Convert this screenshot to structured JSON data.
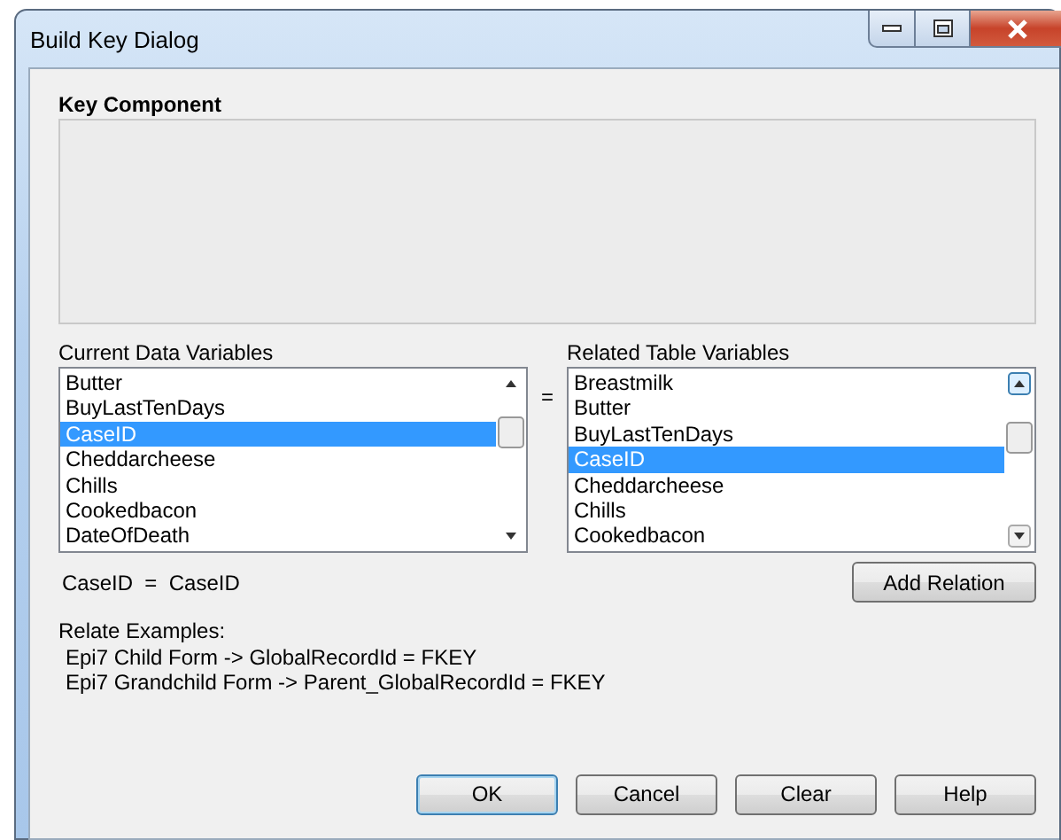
{
  "window": {
    "title": "Build Key Dialog"
  },
  "key_component": {
    "label": "Key Component"
  },
  "current_data_variables": {
    "label": "Current Data Variables",
    "items": [
      {
        "text": "Butter",
        "selected": false
      },
      {
        "text": "BuyLastTenDays",
        "selected": false
      },
      {
        "text": "CaseID",
        "selected": true
      },
      {
        "text": "Cheddarcheese",
        "selected": false
      },
      {
        "text": "Chills",
        "selected": false
      },
      {
        "text": "Cookedbacon",
        "selected": false
      },
      {
        "text": "DateOfDeath",
        "selected": false
      }
    ]
  },
  "equals": "=",
  "related_table_variables": {
    "label": "Related Table Variables",
    "items": [
      {
        "text": "Breastmilk",
        "selected": false
      },
      {
        "text": "Butter",
        "selected": false
      },
      {
        "text": "BuyLastTenDays",
        "selected": false
      },
      {
        "text": "CaseID",
        "selected": true
      },
      {
        "text": "Cheddarcheese",
        "selected": false
      },
      {
        "text": "Chills",
        "selected": false
      },
      {
        "text": "Cookedbacon",
        "selected": false
      }
    ]
  },
  "relation": "CaseID  =  CaseID",
  "add_relation_button": "Add Relation",
  "examples": [
    "Relate Examples:",
    "Epi7 Child Form -> GlobalRecordId = FKEY",
    "Epi7 Grandchild Form -> Parent_GlobalRecordId = FKEY"
  ],
  "buttons": [
    {
      "label": "OK",
      "default": true
    },
    {
      "label": "Cancel",
      "default": false
    },
    {
      "label": "Clear",
      "default": false
    },
    {
      "label": "Help",
      "default": false
    }
  ]
}
